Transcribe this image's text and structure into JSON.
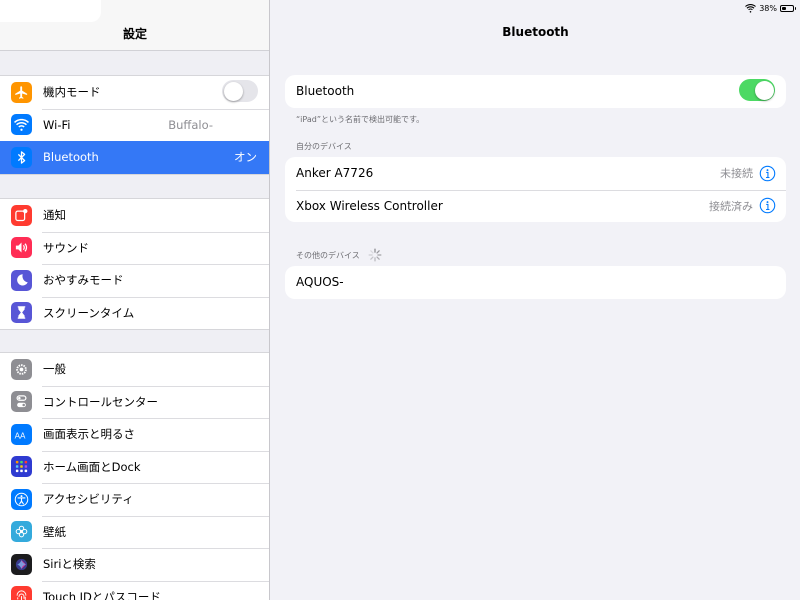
{
  "status_bar": {
    "battery_percent": "38%",
    "battery_level": 0.38
  },
  "sidebar": {
    "title": "設定",
    "groups": [
      {
        "items": [
          {
            "label": "機内モード",
            "icon": "airplane-icon",
            "toggle": false
          },
          {
            "label": "Wi-Fi",
            "icon": "wifi-icon",
            "value": "Buffalo-"
          },
          {
            "label": "Bluetooth",
            "icon": "bluetooth-icon",
            "value": "オン",
            "selected": true
          }
        ]
      },
      {
        "items": [
          {
            "label": "通知",
            "icon": "notifications-icon"
          },
          {
            "label": "サウンド",
            "icon": "sound-icon"
          },
          {
            "label": "おやすみモード",
            "icon": "moon-icon"
          },
          {
            "label": "スクリーンタイム",
            "icon": "hourglass-icon"
          }
        ]
      },
      {
        "items": [
          {
            "label": "一般",
            "icon": "gear-icon"
          },
          {
            "label": "コントロールセンター",
            "icon": "switches-icon"
          },
          {
            "label": "画面表示と明るさ",
            "icon": "text-size-icon"
          },
          {
            "label": "ホーム画面とDock",
            "icon": "home-grid-icon"
          },
          {
            "label": "アクセシビリティ",
            "icon": "accessibility-icon"
          },
          {
            "label": "壁紙",
            "icon": "flower-icon"
          },
          {
            "label": "Siriと検索",
            "icon": "siri-icon"
          },
          {
            "label": "Touch IDとパスコード",
            "icon": "fingerprint-icon"
          }
        ]
      }
    ]
  },
  "detail": {
    "title": "Bluetooth",
    "bluetooth_row": {
      "label": "Bluetooth",
      "toggle": true
    },
    "discoverable_note": "“iPad”という名前で検出可能です。",
    "my_devices_header": "自分のデバイス",
    "my_devices": [
      {
        "name": "Anker A7726",
        "status": "未接続"
      },
      {
        "name": "Xbox Wireless Controller",
        "status": "接続済み"
      }
    ],
    "other_devices_header": "その他のデバイス",
    "other_devices": [
      {
        "name": "AQUOS-"
      }
    ]
  },
  "colors": {
    "accent": "#3478f6",
    "toggle_on": "#4cd964",
    "info_icon": "#007aff"
  }
}
